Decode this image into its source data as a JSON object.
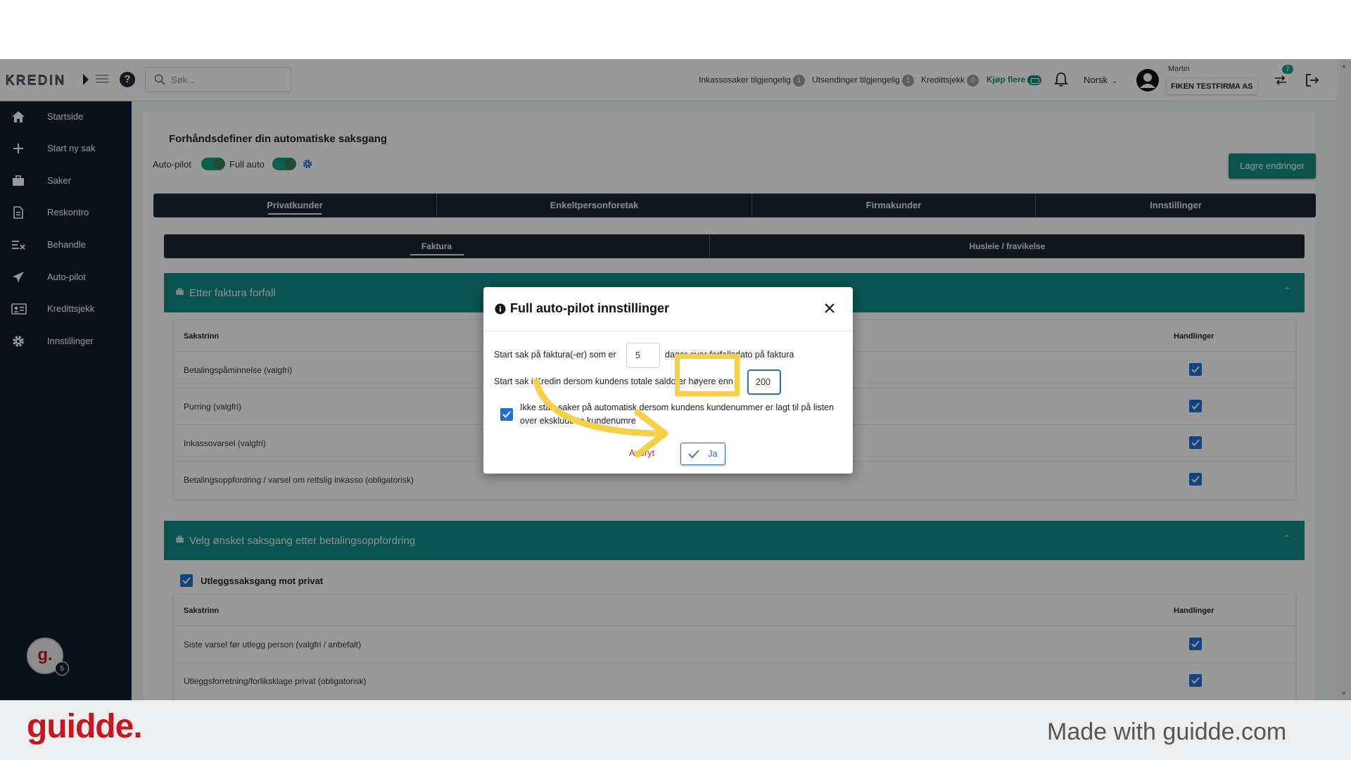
{
  "header": {
    "search_placeholder": "Søk...",
    "stats": [
      {
        "label": "Inkassosaker tilgjengelig",
        "count": "1"
      },
      {
        "label": "Utsendinger tilgjengelig",
        "count": "1"
      },
      {
        "label": "Kredittsjekk",
        "count": "0"
      }
    ],
    "buy_more": "Kjøp flere",
    "language": "Norsk",
    "user_name": "Martin",
    "company": "FIKEN TESTFIRMA AS",
    "swap_badge": "7"
  },
  "sidebar": {
    "items": [
      {
        "label": "Startside",
        "icon": "home-icon"
      },
      {
        "label": "Start ny sak",
        "icon": "plus-icon"
      },
      {
        "label": "Saker",
        "icon": "briefcase-icon"
      },
      {
        "label": "Reskontro",
        "icon": "document-icon"
      },
      {
        "label": "Behandle",
        "icon": "checklist-icon"
      },
      {
        "label": "Auto-pilot",
        "icon": "airplane-icon"
      },
      {
        "label": "Kredittsjekk",
        "icon": "id-card-icon"
      },
      {
        "label": "Innstillinger",
        "icon": "gear-icon"
      }
    ],
    "avatar_letter": "g.",
    "avatar_badge": "5"
  },
  "main": {
    "title": "Forhåndsdefiner din automatiske saksgang",
    "autopilot_label": "Auto-pilot",
    "fullauto_label": "Full auto",
    "save_label": "Lagre endringer",
    "tabs": [
      "Privatkunder",
      "Enkeltpersonforetak",
      "Firmakunder",
      "Innstillinger"
    ],
    "subtabs": [
      "Faktura",
      "Husleie / fravikelse"
    ],
    "panel1": {
      "title": "Etter faktura forfall",
      "col_step": "Sakstrinn",
      "col_actions": "Handlinger",
      "rows": [
        "Betalingspåminnelse (valgfri)",
        "Purring (valgfri)",
        "Inkassovarsel (valgfri)",
        "Betalingsoppfordring / varsel om rettslig inkasso (obligatorisk)"
      ]
    },
    "panel2": {
      "title": "Velg ønsket saksgang etter betalingsoppfordring",
      "checkbox_label": "Utleggssaksgang mot privat",
      "col_step": "Sakstrinn",
      "col_actions": "Handlinger",
      "rows": [
        "Siste varsel før utlegg person (valgfri / anbefalt)",
        "Utleggsforretning/forliksklage privat (obligatorisk)"
      ]
    }
  },
  "modal": {
    "title": "Full auto-pilot innstillinger",
    "line1_before": "Start sak på faktura(-er) som er",
    "days_value": "5",
    "line1_after": "dager over forfallsdato på faktura",
    "line2": "Start sak i Kredin dersom kundens totale saldo er høyere enn",
    "amount_value": "200",
    "exclude_text": "Ikke start saker på automatisk dersom kundens kundenummer er lagt til på listen over ekskluderte kundenumre",
    "cancel_label": "Avbryt",
    "yes_label": "Ja"
  },
  "footer": {
    "brand": "guidde.",
    "made_with": "Made with guidde.com"
  },
  "colors": {
    "sidebar": "#0f1b2b",
    "teal": "#0f8d86",
    "accent": "#138a7e",
    "highlight": "#f7d04a",
    "brand_red": "#c8161d"
  }
}
